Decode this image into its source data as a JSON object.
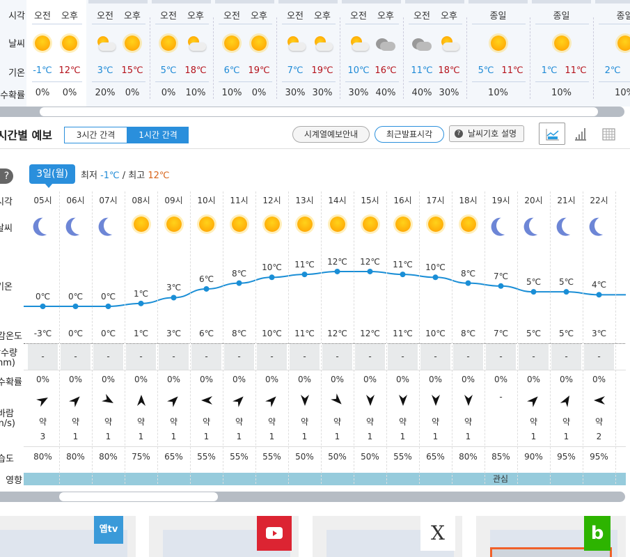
{
  "daily": {
    "labels": {
      "time": "시각",
      "weather": "날씨",
      "temp": "기온",
      "precip": "강수확률"
    },
    "days": [
      {
        "subs": [
          {
            "period": "오전",
            "icon": "sun",
            "temp": "-1℃",
            "prob": "0%"
          },
          {
            "period": "오후",
            "icon": "sun",
            "temp": "12℃",
            "prob": "0%"
          }
        ]
      },
      {
        "subs": [
          {
            "period": "오전",
            "icon": "partly-cloudy",
            "temp": "3℃",
            "prob": "20%"
          },
          {
            "period": "오후",
            "icon": "sun",
            "temp": "15℃",
            "prob": "0%"
          }
        ]
      },
      {
        "subs": [
          {
            "period": "오전",
            "icon": "sun",
            "temp": "5℃",
            "prob": "0%"
          },
          {
            "period": "오후",
            "icon": "partly-cloudy",
            "temp": "18℃",
            "prob": "10%"
          }
        ]
      },
      {
        "subs": [
          {
            "period": "오전",
            "icon": "sun",
            "temp": "6℃",
            "prob": "10%"
          },
          {
            "period": "오후",
            "icon": "sun",
            "temp": "19℃",
            "prob": "0%"
          }
        ]
      },
      {
        "subs": [
          {
            "period": "오전",
            "icon": "partly-cloudy",
            "temp": "7℃",
            "prob": "30%"
          },
          {
            "period": "오후",
            "icon": "partly-cloudy",
            "temp": "19℃",
            "prob": "30%"
          }
        ]
      },
      {
        "subs": [
          {
            "period": "오전",
            "icon": "partly-cloudy",
            "temp": "10℃",
            "prob": "30%"
          },
          {
            "period": "오후",
            "icon": "cloudy",
            "temp": "16℃",
            "prob": "40%"
          }
        ]
      },
      {
        "subs": [
          {
            "period": "오전",
            "icon": "cloudy",
            "temp": "11℃",
            "prob": "40%"
          },
          {
            "period": "오후",
            "icon": "partly-cloudy",
            "temp": "18℃",
            "prob": "30%"
          }
        ]
      },
      {
        "allday": true,
        "period": "종일",
        "icon": "sun",
        "min": "5℃",
        "max": "11℃",
        "prob": "10%"
      },
      {
        "allday": true,
        "period": "종일",
        "icon": "sun",
        "min": "1℃",
        "max": "11℃",
        "prob": "10%"
      },
      {
        "allday": true,
        "period": "종일",
        "icon": "sun",
        "min": "2℃",
        "max": "",
        "prob": "10%"
      }
    ]
  },
  "hourly": {
    "title": "시간별 예보",
    "tabs": [
      "3시간 간격",
      "1시간 간격"
    ],
    "buttons": {
      "series": "시계열예보안내",
      "recent": "최근발표시각",
      "legend": "날씨기호 설명"
    },
    "day_badge": "3일(월)",
    "min_label": "최저",
    "min": "-1℃",
    "sep": "/",
    "max_label": "최고",
    "max": "12℃",
    "labels": {
      "time": "시각",
      "weather": "날씨",
      "temp": "기온",
      "feels": "체감온도",
      "rain": "강수량",
      "rain_unit": "(mm)",
      "prob": "강수확률",
      "wind": "바람",
      "wind_unit": "(m/s)",
      "humidity": "습도",
      "impact": "영향"
    },
    "impact_text": "관심",
    "hours": [
      {
        "time": "05시",
        "icon": "moon",
        "temp": 0,
        "temp_label": "0℃",
        "feels": "-3℃",
        "rain": "-",
        "prob": "0%",
        "wind_dir": 60,
        "wind_str": "약",
        "wind_speed": "3",
        "humidity": "80%"
      },
      {
        "time": "06시",
        "icon": "moon",
        "temp": 0,
        "temp_label": "0℃",
        "feels": "0℃",
        "rain": "-",
        "prob": "0%",
        "wind_dir": 45,
        "wind_str": "약",
        "wind_speed": "1",
        "humidity": "80%"
      },
      {
        "time": "07시",
        "icon": "moon",
        "temp": 0,
        "temp_label": "0℃",
        "feels": "0℃",
        "rain": "-",
        "prob": "0%",
        "wind_dir": 120,
        "wind_str": "약",
        "wind_speed": "1",
        "humidity": "80%"
      },
      {
        "time": "08시",
        "icon": "sun",
        "temp": 1,
        "temp_label": "1℃",
        "feels": "1℃",
        "rain": "-",
        "prob": "0%",
        "wind_dir": 0,
        "wind_str": "약",
        "wind_speed": "1",
        "humidity": "75%"
      },
      {
        "time": "09시",
        "icon": "sun",
        "temp": 3,
        "temp_label": "3℃",
        "feels": "3℃",
        "rain": "-",
        "prob": "0%",
        "wind_dir": 45,
        "wind_str": "약",
        "wind_speed": "1",
        "humidity": "65%"
      },
      {
        "time": "10시",
        "icon": "sun",
        "temp": 6,
        "temp_label": "6℃",
        "feels": "6℃",
        "rain": "-",
        "prob": "0%",
        "wind_dir": 270,
        "wind_str": "약",
        "wind_speed": "1",
        "humidity": "55%"
      },
      {
        "time": "11시",
        "icon": "sun",
        "temp": 8,
        "temp_label": "8℃",
        "feels": "8℃",
        "rain": "-",
        "prob": "0%",
        "wind_dir": 45,
        "wind_str": "약",
        "wind_speed": "1",
        "humidity": "55%"
      },
      {
        "time": "12시",
        "icon": "sun",
        "temp": 10,
        "temp_label": "10℃",
        "feels": "10℃",
        "rain": "-",
        "prob": "0%",
        "wind_dir": 45,
        "wind_str": "약",
        "wind_speed": "1",
        "humidity": "55%"
      },
      {
        "time": "13시",
        "icon": "sun",
        "temp": 11,
        "temp_label": "11℃",
        "feels": "11℃",
        "rain": "-",
        "prob": "0%",
        "wind_dir": 180,
        "wind_str": "약",
        "wind_speed": "1",
        "humidity": "50%"
      },
      {
        "time": "14시",
        "icon": "sun",
        "temp": 12,
        "temp_label": "12℃",
        "feels": "12℃",
        "rain": "-",
        "prob": "0%",
        "wind_dir": 135,
        "wind_str": "약",
        "wind_speed": "1",
        "humidity": "50%"
      },
      {
        "time": "15시",
        "icon": "sun",
        "temp": 12,
        "temp_label": "12℃",
        "feels": "12℃",
        "rain": "-",
        "prob": "0%",
        "wind_dir": 180,
        "wind_str": "약",
        "wind_speed": "1",
        "humidity": "50%"
      },
      {
        "time": "16시",
        "icon": "sun",
        "temp": 11,
        "temp_label": "11℃",
        "feels": "11℃",
        "rain": "-",
        "prob": "0%",
        "wind_dir": 180,
        "wind_str": "약",
        "wind_speed": "1",
        "humidity": "55%"
      },
      {
        "time": "17시",
        "icon": "sun",
        "temp": 10,
        "temp_label": "10℃",
        "feels": "10℃",
        "rain": "-",
        "prob": "0%",
        "wind_dir": 180,
        "wind_str": "약",
        "wind_speed": "1",
        "humidity": "65%"
      },
      {
        "time": "18시",
        "icon": "sun",
        "temp": 8,
        "temp_label": "8℃",
        "feels": "8℃",
        "rain": "-",
        "prob": "0%",
        "wind_dir": 180,
        "wind_str": "약",
        "wind_speed": "1",
        "humidity": "80%"
      },
      {
        "time": "19시",
        "icon": "moon",
        "temp": 7,
        "temp_label": "7℃",
        "feels": "7℃",
        "rain": "-",
        "prob": "0%",
        "wind_dir": null,
        "wind_str": "",
        "wind_speed": "",
        "humidity": "85%"
      },
      {
        "time": "20시",
        "icon": "moon",
        "temp": 5,
        "temp_label": "5℃",
        "feels": "5℃",
        "rain": "-",
        "prob": "0%",
        "wind_dir": 45,
        "wind_str": "약",
        "wind_speed": "1",
        "humidity": "90%"
      },
      {
        "time": "21시",
        "icon": "moon",
        "temp": 5,
        "temp_label": "5℃",
        "feels": "5℃",
        "rain": "-",
        "prob": "0%",
        "wind_dir": 30,
        "wind_str": "약",
        "wind_speed": "1",
        "humidity": "95%"
      },
      {
        "time": "22시",
        "icon": "moon",
        "temp": 4,
        "temp_label": "4℃",
        "feels": "3℃",
        "rain": "-",
        "prob": "0%",
        "wind_dir": 270,
        "wind_str": "약",
        "wind_speed": "2",
        "humidity": "95%"
      }
    ],
    "no_wind": "-"
  },
  "social": [
    {
      "name": "옙tv",
      "color": "#3a9ad9"
    },
    {
      "name": "youtube",
      "color": "#dc2432"
    },
    {
      "name": "X",
      "color": "#ffffff"
    },
    {
      "name": "b",
      "color": "#2db400"
    }
  ]
}
